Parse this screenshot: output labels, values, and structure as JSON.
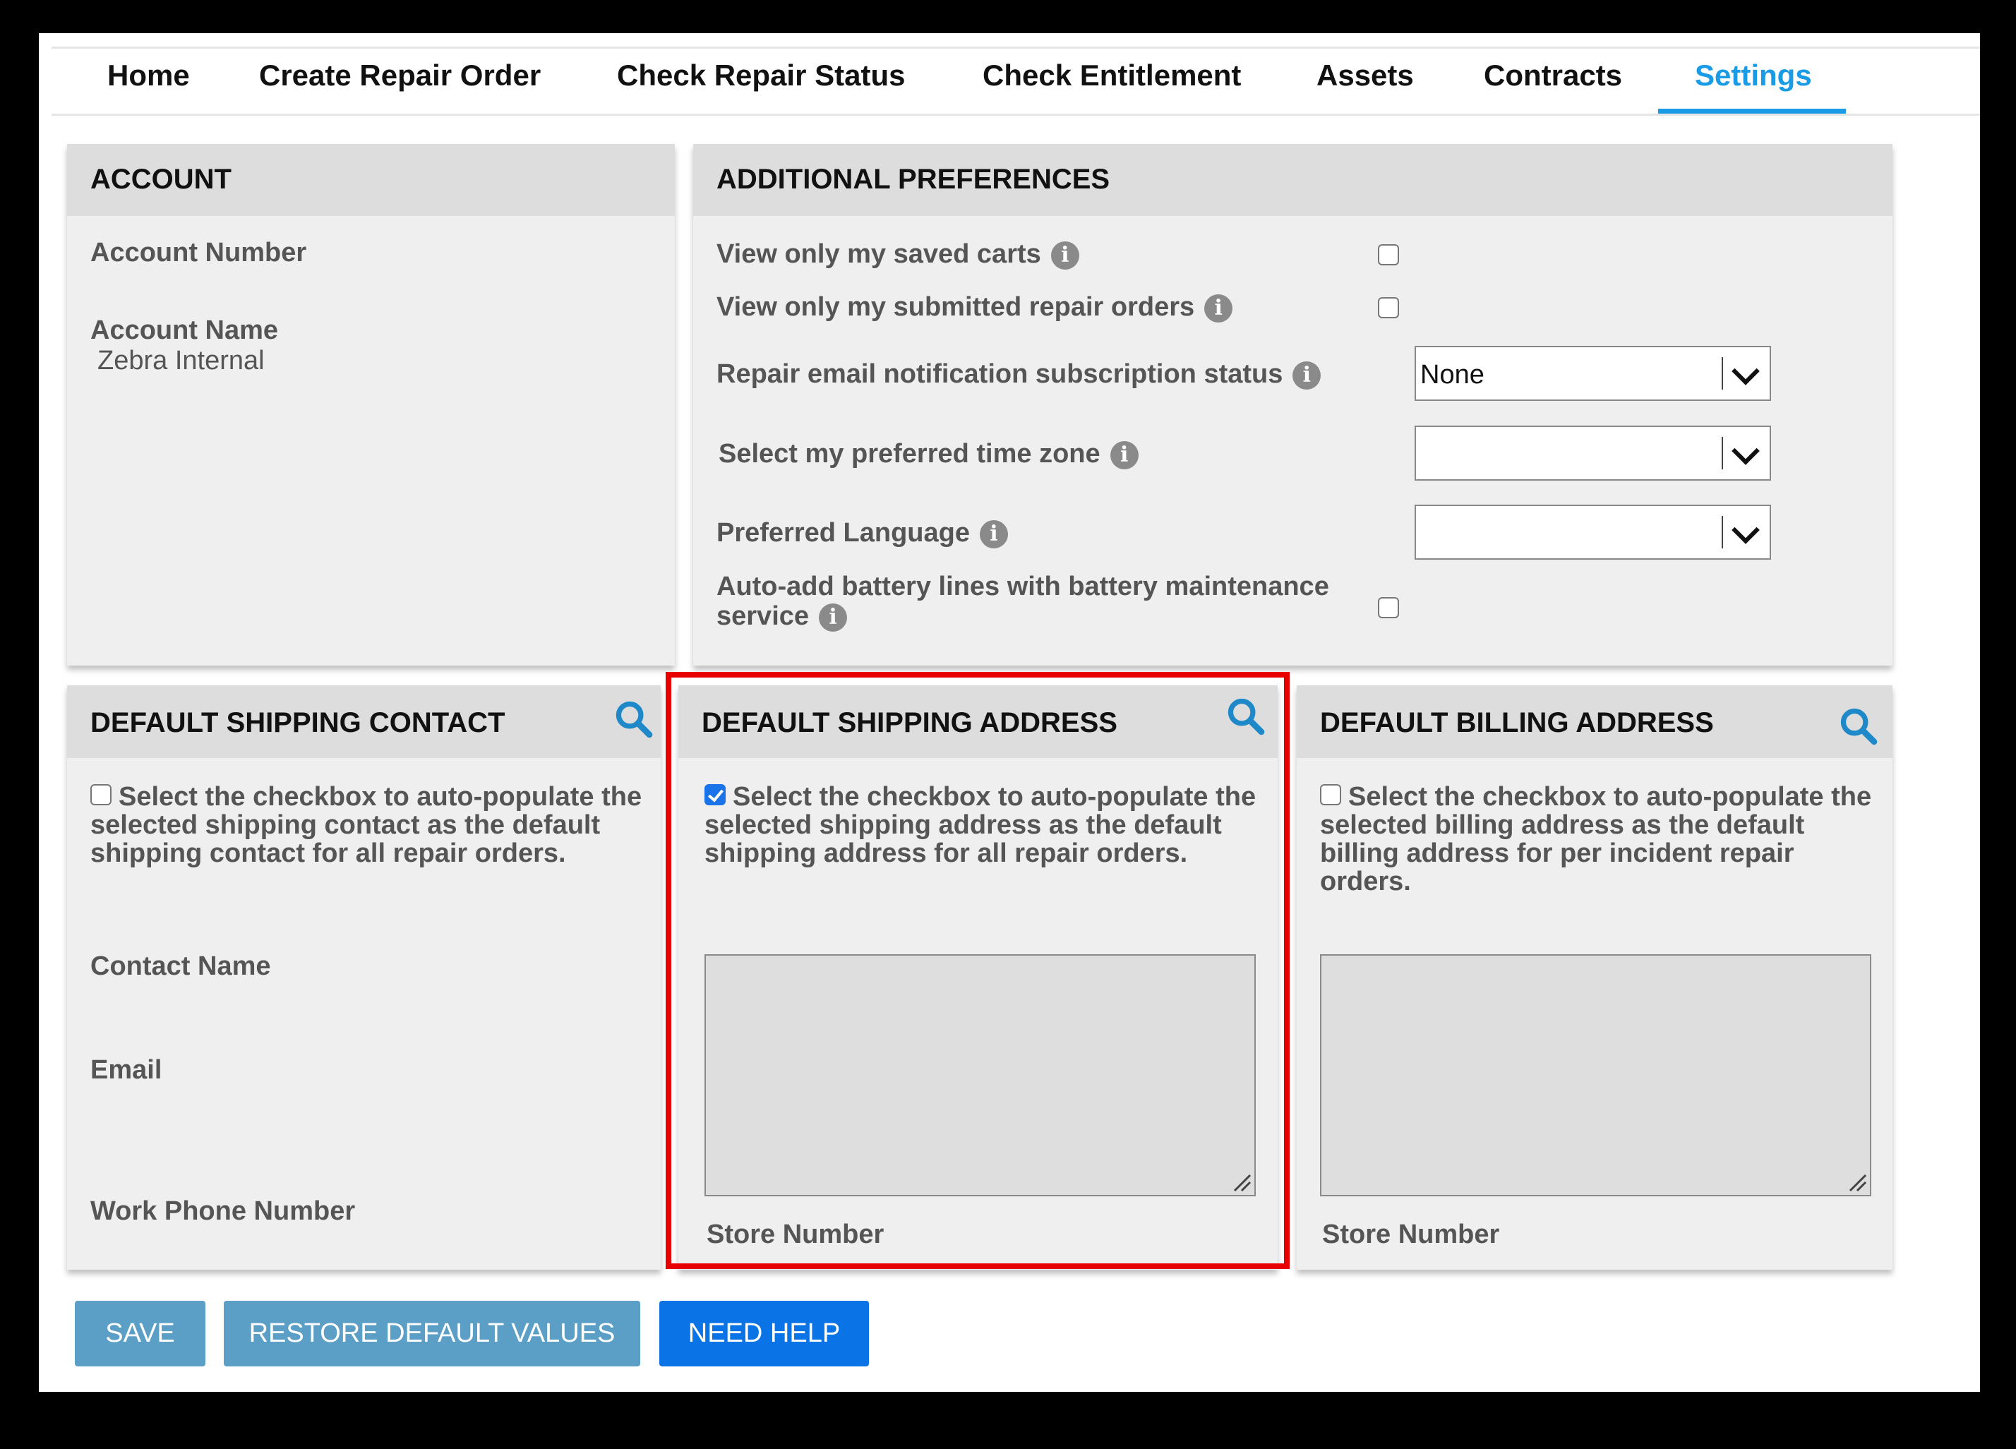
{
  "nav": {
    "items": [
      "Home",
      "Create Repair Order",
      "Check Repair Status",
      "Check Entitlement",
      "Assets",
      "Contracts",
      "Settings"
    ],
    "active": "Settings"
  },
  "account": {
    "title": "ACCOUNT",
    "account_number_label": "Account Number",
    "account_number_value": "",
    "account_name_label": "Account Name",
    "account_name_value": "Zebra Internal"
  },
  "preferences": {
    "title": "ADDITIONAL PREFERENCES",
    "saved_carts": {
      "label": "View only my saved carts",
      "checked": false
    },
    "submitted_orders": {
      "label": "View only my submitted repair orders",
      "checked": false
    },
    "email_notification": {
      "label": "Repair email notification subscription status",
      "value": "None"
    },
    "time_zone": {
      "label": "Select my preferred time zone",
      "value": ""
    },
    "language": {
      "label": "Preferred Language",
      "value": ""
    },
    "battery": {
      "label_line1": "Auto-add battery lines with battery maintenance",
      "label_line2": "service",
      "checked": false
    }
  },
  "shipping_contact": {
    "title": "DEFAULT SHIPPING CONTACT",
    "checkbox_checked": false,
    "description": "Select the checkbox to auto-populate the selected shipping contact as the default shipping contact for all repair orders.",
    "contact_name_label": "Contact Name",
    "email_label": "Email",
    "phone_label": "Work Phone Number"
  },
  "shipping_address": {
    "title": "DEFAULT SHIPPING ADDRESS",
    "checkbox_checked": true,
    "description": "Select the checkbox to auto-populate the selected shipping address as the default shipping address for all repair orders.",
    "address_value": "",
    "store_number_label": "Store Number",
    "highlighted": true
  },
  "billing_address": {
    "title": "DEFAULT BILLING ADDRESS",
    "checkbox_checked": false,
    "description": "Select the checkbox to auto-populate the selected billing address as the default billing address for per incident repair orders.",
    "address_value": "",
    "store_number_label": "Store Number"
  },
  "buttons": {
    "save": "SAVE",
    "restore": "RESTORE DEFAULT VALUES",
    "help": "NEED HELP"
  },
  "colors": {
    "accent": "#1a9be6",
    "muted_button": "#5b9ec6",
    "primary_button": "#0a74e6",
    "highlight": "#e80000",
    "search_icon": "#1e88c8"
  },
  "icons": {
    "info": "info-icon",
    "search": "search-icon",
    "dropdown": "chevron-down-icon"
  }
}
